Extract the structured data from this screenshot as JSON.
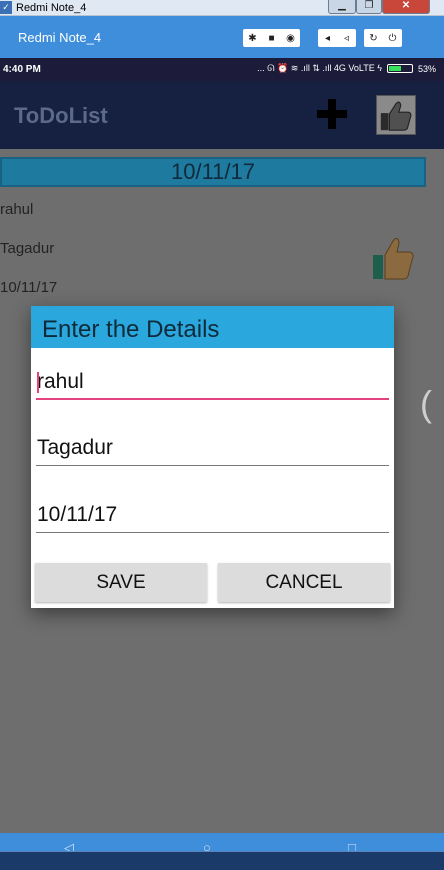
{
  "window": {
    "title": "Redmi Note_4",
    "minimize": "▁",
    "maximize": "❐",
    "close": "✕"
  },
  "emulator": {
    "device_name": "Redmi Note_4"
  },
  "status_bar": {
    "time": "4:40 PM",
    "indicators": "... ᘏ ⏰ ≋ .ıll ⇅ .ıll 4G VoLTE ϟ",
    "battery": "53%",
    "battery_level": 0.53
  },
  "app_bar": {
    "title": "ToDoList"
  },
  "list": {
    "date_header": "10/11/17",
    "items": [
      "rahul",
      "Tagadur",
      "10/11/17"
    ]
  },
  "dialog": {
    "title": "Enter the Details",
    "fields": [
      {
        "value": "rahul"
      },
      {
        "value": "Tagadur"
      },
      {
        "value": "10/11/17"
      }
    ],
    "save_label": "SAVE",
    "cancel_label": "CANCEL"
  },
  "colors": {
    "accent": "#e5437f",
    "dialog_header": "#2aa7dc",
    "app_bar": "#162040"
  }
}
